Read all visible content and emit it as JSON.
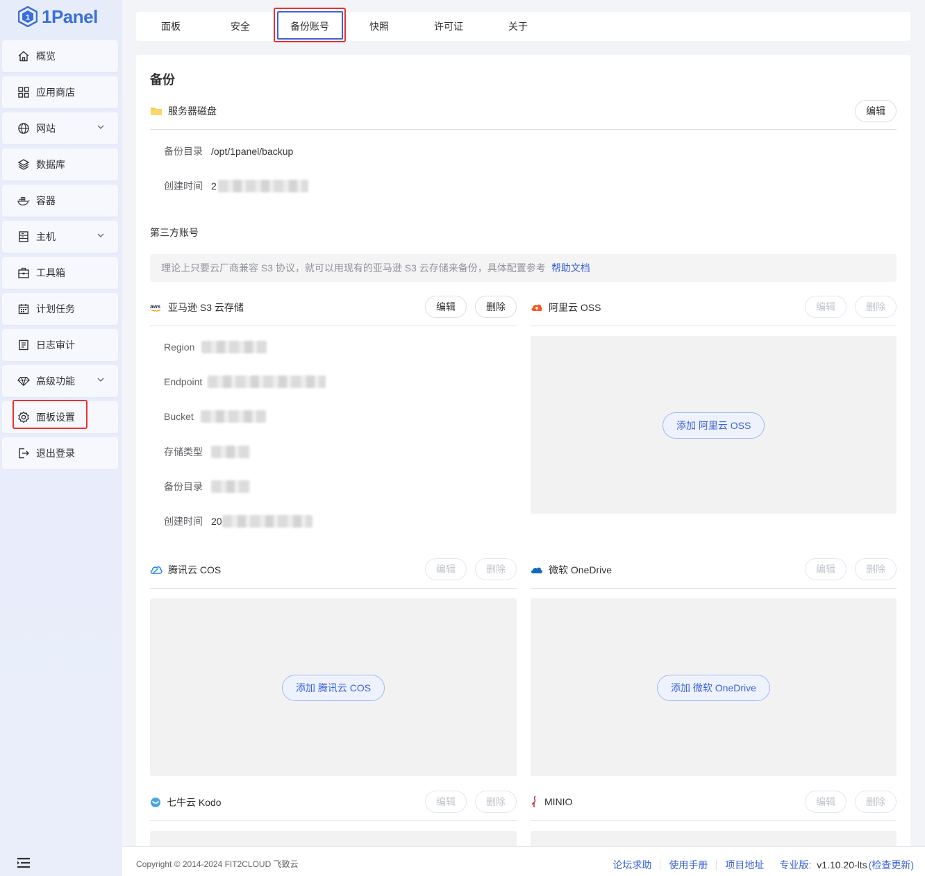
{
  "app": {
    "logo_text": "1Panel"
  },
  "sidebar": {
    "items": [
      {
        "label": "概览",
        "icon": "home-icon"
      },
      {
        "label": "应用商店",
        "icon": "apps-grid-icon"
      },
      {
        "label": "网站",
        "icon": "globe-icon",
        "expandable": true
      },
      {
        "label": "数据库",
        "icon": "layers-icon"
      },
      {
        "label": "容器",
        "icon": "docker-icon"
      },
      {
        "label": "主机",
        "icon": "server-icon",
        "expandable": true
      },
      {
        "label": "工具箱",
        "icon": "toolbox-icon"
      },
      {
        "label": "计划任务",
        "icon": "calendar-icon"
      },
      {
        "label": "日志审计",
        "icon": "log-icon"
      },
      {
        "label": "高级功能",
        "icon": "diamond-icon",
        "expandable": true
      },
      {
        "label": "面板设置",
        "icon": "gear-icon",
        "active": true
      },
      {
        "label": "退出登录",
        "icon": "logout-icon"
      }
    ]
  },
  "tabs": [
    {
      "label": "面板"
    },
    {
      "label": "安全"
    },
    {
      "label": "备份账号",
      "active": true
    },
    {
      "label": "快照"
    },
    {
      "label": "许可证"
    },
    {
      "label": "关于"
    }
  ],
  "backup": {
    "title": "备份",
    "server_disk": {
      "name": "服务器磁盘",
      "edit_label": "编辑",
      "dir_label": "备份目录",
      "dir_value": "/opt/1panel/backup",
      "created_label": "创建时间",
      "created_value": "2"
    },
    "third_party_title": "第三方账号",
    "tip_text": "理论上只要云厂商兼容 S3 协议，就可以用现有的亚马逊 S3 云存储来备份，具体配置参考",
    "tip_link": "帮助文档",
    "s3": {
      "name": "亚马逊 S3 云存储",
      "edit_label": "编辑",
      "delete_label": "删除",
      "fields": [
        {
          "label": "Region",
          "value": ""
        },
        {
          "label": "Endpoint",
          "value": ""
        },
        {
          "label": "Bucket",
          "value": ""
        },
        {
          "label": "存储类型",
          "value": ""
        },
        {
          "label": "备份目录",
          "value": ""
        },
        {
          "label": "创建时间",
          "value": "20"
        }
      ]
    },
    "oss": {
      "name": "阿里云 OSS",
      "edit_label": "编辑",
      "delete_label": "删除",
      "add_label": "添加 阿里云 OSS"
    },
    "cos": {
      "name": "腾讯云 COS",
      "edit_label": "编辑",
      "delete_label": "删除",
      "add_label": "添加 腾讯云 COS"
    },
    "onedrive": {
      "name": "微软 OneDrive",
      "edit_label": "编辑",
      "delete_label": "删除",
      "add_label": "添加 微软 OneDrive"
    },
    "kodo": {
      "name": "七牛云 Kodo",
      "edit_label": "编辑",
      "delete_label": "删除"
    },
    "minio": {
      "name": "MINIO",
      "edit_label": "编辑",
      "delete_label": "删除"
    }
  },
  "footer": {
    "copyright": "Copyright © 2014-2024 FIT2CLOUD 飞致云",
    "links": [
      "论坛求助",
      "使用手册",
      "项目地址"
    ],
    "edition_label": "专业版:",
    "version": "v1.10.20-lts",
    "check_update": "(检查更新)"
  },
  "colors": {
    "accent": "#3a62d8",
    "highlight": "#e8312f",
    "brand": "#3a6fd8"
  }
}
